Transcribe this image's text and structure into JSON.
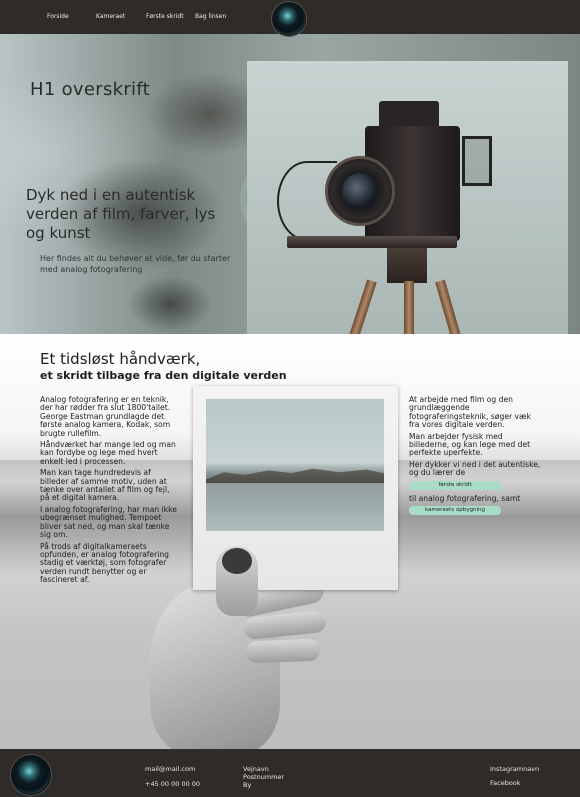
{
  "nav": {
    "links": [
      "Forside",
      "Kameraet",
      "Første skridt",
      "Bag linsen"
    ],
    "logo_icon": "camera-lens-logo"
  },
  "hero": {
    "heading": "H1 overskrift",
    "subheading": "Dyk ned i en autentisk verden af film, farver, lys og kunst",
    "tagline": "Her findes alt du behøver at vide, før du starter med analog fotografering"
  },
  "section": {
    "title": "Et tidsløst håndværk,",
    "subtitle": "et skridt tilbage fra den digitale verden",
    "left_paragraphs": [
      "Analog fotografering er en teknik, der har rødder fra slut 1800'tallet. George Eastman grundlagde det første analog kamera, Kodak, som brugte rullefilm.",
      "Håndværket har mange led og man kan fordybe og lege med hvert enkelt led i processen.",
      "Man kan tage hundredevis af billeder af samme motiv, uden at tænke over antallet af film og fejl, på et digital kamera.",
      "I analog fotografering, har man ikke ubegrænset mulighed. Tempoet bliver sat ned, og man skal tænke sig om.",
      "På trods af digitalkameraets opfunden, er analog fotografering stadig et værktøj, som fotografer verden rundt benytter og er fascineret af."
    ],
    "right_paragraphs": [
      "At arbejde med film og den grundlæggende fotograferingsteknik, søger væk fra vores digitale verden.",
      "Man arbejder fysisk med billederne, og kan lege med det perfekte uperfekte.",
      "Her dykker vi ned i det autentiske, og du lærer de"
    ],
    "button_first_steps": "første skridt",
    "connector_text": "til analog fotografering, samt",
    "button_camera_build": "kameraets opbygning"
  },
  "footer": {
    "email": "mail@mail.com",
    "phone": "+45 00 00 00 00",
    "address": [
      "Vejnavn",
      "Postnummer",
      "By"
    ],
    "social": [
      "Instagramnavn",
      "Facebook"
    ]
  },
  "colors": {
    "nav_bg": "#2e2b29",
    "button_accent": "#a8dcc7",
    "text_dark": "#1e1e1e"
  }
}
